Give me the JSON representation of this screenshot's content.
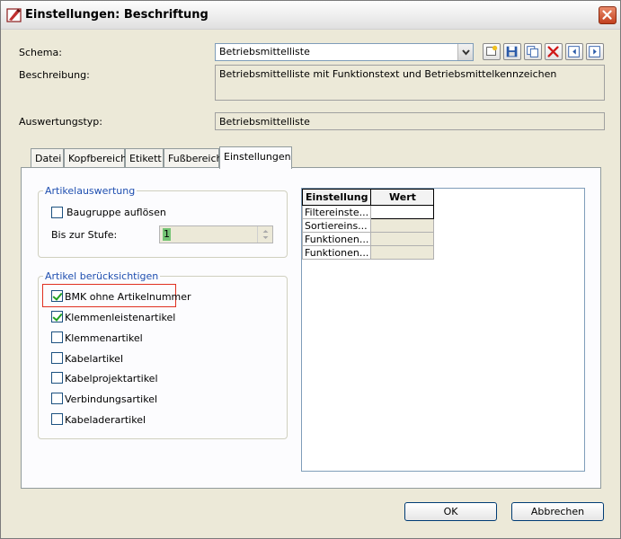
{
  "window": {
    "title": "Einstellungen: Beschriftung"
  },
  "schema": {
    "label": "Schema:",
    "value": "Betriebsmittelliste",
    "toolbar_icons": [
      "new-schema-icon",
      "save-icon",
      "copy-icon",
      "delete-icon",
      "import-icon",
      "export-icon"
    ]
  },
  "beschreibung": {
    "label": "Beschreibung:",
    "value": "Betriebsmittelliste mit Funktionstext und Betriebsmittelkennzeichen"
  },
  "auswertungstyp": {
    "label": "Auswertungstyp:",
    "value": "Betriebsmittelliste"
  },
  "tabs": [
    {
      "label": "Datei",
      "active": false
    },
    {
      "label": "Kopfbereich",
      "active": false
    },
    {
      "label": "Etikett",
      "active": false
    },
    {
      "label": "Fußbereich",
      "active": false
    },
    {
      "label": "Einstellungen",
      "active": true
    }
  ],
  "artikelauswertung": {
    "title": "Artikelauswertung",
    "baugruppe_label": "Baugruppe auflösen",
    "baugruppe_checked": false,
    "stufe_label": "Bis zur Stufe:",
    "stufe_value": "1"
  },
  "artikel_beruecksichtigen": {
    "title": "Artikel berücksichtigen",
    "items": [
      {
        "label": "BMK ohne Artikelnummer",
        "checked": true
      },
      {
        "label": "Klemmenleistenartikel",
        "checked": true
      },
      {
        "label": "Klemmenartikel",
        "checked": false
      },
      {
        "label": "Kabelartikel",
        "checked": false
      },
      {
        "label": "Kabelprojektartikel",
        "checked": false
      },
      {
        "label": "Verbindungsartikel",
        "checked": false
      },
      {
        "label": "Kabeladerartikel",
        "checked": false
      }
    ]
  },
  "grid": {
    "headers": [
      "Einstellung",
      "Wert"
    ],
    "rows": [
      {
        "name": "Filtereinste...",
        "value": ""
      },
      {
        "name": "Sortiereins...",
        "value": ""
      },
      {
        "name": "Funktionen...",
        "value": ""
      },
      {
        "name": "Funktionen...",
        "value": ""
      }
    ]
  },
  "buttons": {
    "ok": "OK",
    "cancel": "Abbrechen"
  },
  "colors": {
    "highlight_box": "#e03020",
    "group_title": "#1f4fb0",
    "dialog_bg": "#ece9d8"
  }
}
